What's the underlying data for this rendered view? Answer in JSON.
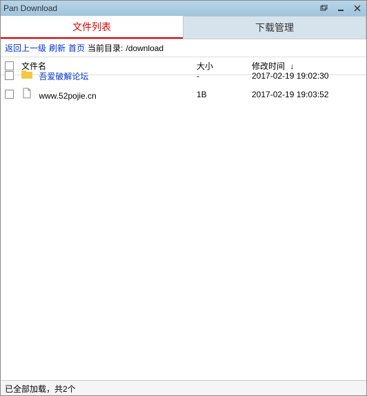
{
  "window": {
    "title": "Pan Download"
  },
  "tabs": {
    "file_list": "文件列表",
    "download_mgr": "下载管理"
  },
  "toolbar": {
    "back": "返回上一级",
    "refresh": "刷新",
    "home": "首页",
    "current_dir_label": "当前目录:",
    "current_dir": "/download"
  },
  "columns": {
    "name": "文件名",
    "size": "大小",
    "mtime": "修改时间",
    "sort_indicator": "↓"
  },
  "files": [
    {
      "name": "吾爱破解论坛",
      "size": "-",
      "mtime": "2017-02-19 19:02:30",
      "type": "folder"
    },
    {
      "name": "www.52pojie.cn",
      "size": "1B",
      "mtime": "2017-02-19 19:03:52",
      "type": "file"
    }
  ],
  "status": "已全部加载，共2个"
}
